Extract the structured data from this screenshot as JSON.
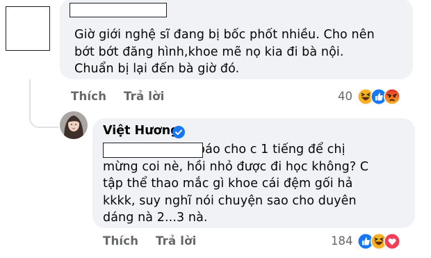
{
  "comment1": {
    "text_lines": [
      "Giờ giới nghệ sĩ đang bị bốc phốt nhiều. Cho nên",
      "bớt bớt đăng hình,khoe mẽ nọ kia đi bà nội.",
      "Chuẩn bị lại đến bà giờ đó."
    ],
    "like_label": "Thích",
    "reply_label": "Trả lời",
    "reaction_count": "40",
    "reactions": [
      "haha",
      "like",
      "angry"
    ]
  },
  "comment2": {
    "author": "Việt Hương",
    "verified": true,
    "text_lines": [
      "                        báo cho c 1 tiếng để chị",
      "mừng coi nè, hồi nhỏ được đi học không? C",
      "tập thể thao mắc gì khoe cái đệm gối hả",
      "kkkk, suy nghĩ nói chuyện sao cho duyên",
      "dáng nà 2...3 nà."
    ],
    "like_label": "Thích",
    "reply_label": "Trả lời",
    "reaction_count": "184",
    "reactions": [
      "like",
      "haha",
      "love"
    ]
  },
  "colors": {
    "bubble": "#f0f2f5",
    "secondary_text": "#65676b",
    "like_blue": "#1877f2",
    "haha_yellow": "#f7b125",
    "love_red": "#f33e58",
    "angry_orange": "#e9710f"
  }
}
